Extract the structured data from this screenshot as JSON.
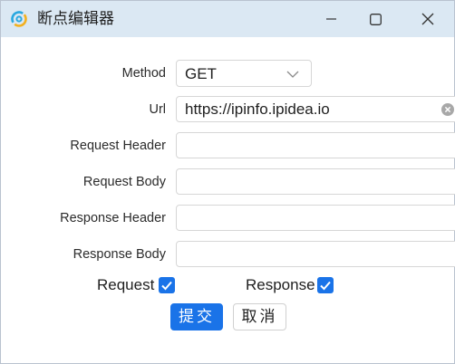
{
  "window": {
    "title": "断点编辑器",
    "minimize_icon": "minimize-icon",
    "maximize_icon": "maximize-icon",
    "close_icon": "close-icon",
    "app_icon": "app-logo-icon"
  },
  "form": {
    "method_label": "Method",
    "method_value": "GET",
    "url_label": "Url",
    "url_value": "https://ipinfo.ipidea.io",
    "request_header_label": "Request Header",
    "request_header_value": "",
    "request_body_label": "Request Body",
    "request_body_value": "",
    "response_header_label": "Response Header",
    "response_header_value": "",
    "response_body_label": "Response Body",
    "response_body_value": ""
  },
  "options": {
    "request_label": "Request",
    "request_checked": true,
    "response_label": "Response",
    "response_checked": true
  },
  "actions": {
    "submit_label": "提交",
    "cancel_label": "取消"
  },
  "colors": {
    "accent": "#1a73e8",
    "titlebar": "#dbe8f3"
  }
}
